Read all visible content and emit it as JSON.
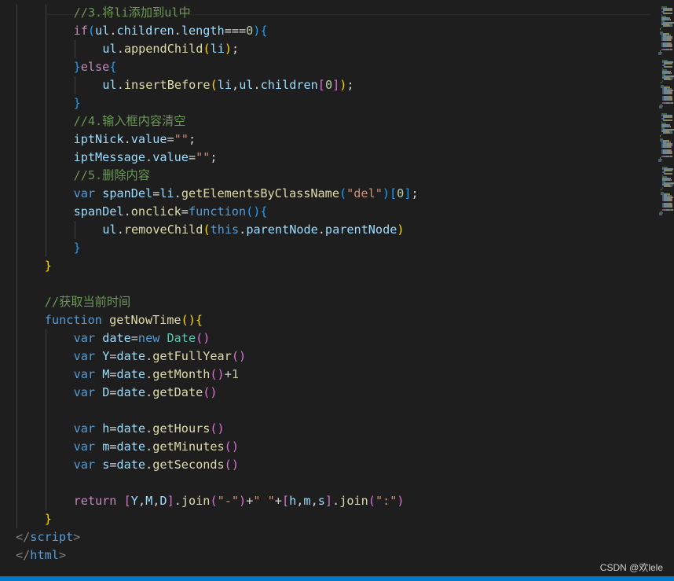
{
  "watermark": "CSDN @欢lele",
  "colors": {
    "background": "#1e1e1e",
    "comment": "#6a9955",
    "control_keyword": "#c586c0",
    "storage_keyword": "#569cd6",
    "variable": "#9cdcfe",
    "function": "#dcdcaa",
    "type": "#4ec9b0",
    "string": "#ce9178",
    "number": "#b5cea8",
    "bracket_level_1": "#ffd700",
    "bracket_level_2": "#da70d6",
    "bracket_level_3": "#179fff",
    "statusbar": "#007acc"
  },
  "code_lines": [
    {
      "indent": 2,
      "tokens": [
        {
          "t": "//3.将li添加到ul中",
          "c": "cm"
        }
      ]
    },
    {
      "indent": 2,
      "tokens": [
        {
          "t": "if",
          "c": "kw"
        },
        {
          "t": "(",
          "c": "b3"
        },
        {
          "t": "ul",
          "c": "vr"
        },
        {
          "t": ".",
          "c": "op"
        },
        {
          "t": "children",
          "c": "vr"
        },
        {
          "t": ".",
          "c": "op"
        },
        {
          "t": "length",
          "c": "vr"
        },
        {
          "t": "===",
          "c": "op"
        },
        {
          "t": "0",
          "c": "nm"
        },
        {
          "t": ")",
          "c": "b3"
        },
        {
          "t": "{",
          "c": "b3"
        }
      ]
    },
    {
      "indent": 3,
      "tokens": [
        {
          "t": "ul",
          "c": "vr"
        },
        {
          "t": ".",
          "c": "op"
        },
        {
          "t": "appendChild",
          "c": "fn"
        },
        {
          "t": "(",
          "c": "b1"
        },
        {
          "t": "li",
          "c": "vr"
        },
        {
          "t": ")",
          "c": "b1"
        },
        {
          "t": ";",
          "c": "op"
        }
      ]
    },
    {
      "indent": 2,
      "tokens": [
        {
          "t": "}",
          "c": "b3"
        },
        {
          "t": "else",
          "c": "kw"
        },
        {
          "t": "{",
          "c": "b3"
        }
      ]
    },
    {
      "indent": 3,
      "tokens": [
        {
          "t": "ul",
          "c": "vr"
        },
        {
          "t": ".",
          "c": "op"
        },
        {
          "t": "insertBefore",
          "c": "fn"
        },
        {
          "t": "(",
          "c": "b1"
        },
        {
          "t": "li",
          "c": "vr"
        },
        {
          "t": ",",
          "c": "op"
        },
        {
          "t": "ul",
          "c": "vr"
        },
        {
          "t": ".",
          "c": "op"
        },
        {
          "t": "children",
          "c": "vr"
        },
        {
          "t": "[",
          "c": "b2"
        },
        {
          "t": "0",
          "c": "nm"
        },
        {
          "t": "]",
          "c": "b2"
        },
        {
          "t": ")",
          "c": "b1"
        },
        {
          "t": ";",
          "c": "op"
        }
      ]
    },
    {
      "indent": 2,
      "tokens": [
        {
          "t": "}",
          "c": "b3"
        }
      ]
    },
    {
      "indent": 2,
      "tokens": [
        {
          "t": "//4.输入框内容清空",
          "c": "cm"
        }
      ]
    },
    {
      "indent": 2,
      "tokens": [
        {
          "t": "iptNick",
          "c": "vr"
        },
        {
          "t": ".",
          "c": "op"
        },
        {
          "t": "value",
          "c": "vr"
        },
        {
          "t": "=",
          "c": "op"
        },
        {
          "t": "\"\"",
          "c": "sr"
        },
        {
          "t": ";",
          "c": "op"
        }
      ]
    },
    {
      "indent": 2,
      "tokens": [
        {
          "t": "iptMessage",
          "c": "vr"
        },
        {
          "t": ".",
          "c": "op"
        },
        {
          "t": "value",
          "c": "vr"
        },
        {
          "t": "=",
          "c": "op"
        },
        {
          "t": "\"\"",
          "c": "sr"
        },
        {
          "t": ";",
          "c": "op"
        }
      ]
    },
    {
      "indent": 2,
      "tokens": [
        {
          "t": "//5.删除内容",
          "c": "cm"
        }
      ]
    },
    {
      "indent": 2,
      "tokens": [
        {
          "t": "var",
          "c": "st"
        },
        {
          "t": " ",
          "c": "op"
        },
        {
          "t": "spanDel",
          "c": "vr"
        },
        {
          "t": "=",
          "c": "op"
        },
        {
          "t": "li",
          "c": "vr"
        },
        {
          "t": ".",
          "c": "op"
        },
        {
          "t": "getElementsByClassName",
          "c": "fn"
        },
        {
          "t": "(",
          "c": "b3"
        },
        {
          "t": "\"del\"",
          "c": "sr"
        },
        {
          "t": ")",
          "c": "b3"
        },
        {
          "t": "[",
          "c": "b3"
        },
        {
          "t": "0",
          "c": "nm"
        },
        {
          "t": "]",
          "c": "b3"
        },
        {
          "t": ";",
          "c": "op"
        }
      ]
    },
    {
      "indent": 2,
      "tokens": [
        {
          "t": "spanDel",
          "c": "vr"
        },
        {
          "t": ".",
          "c": "op"
        },
        {
          "t": "onclick",
          "c": "fn"
        },
        {
          "t": "=",
          "c": "op"
        },
        {
          "t": "function",
          "c": "st"
        },
        {
          "t": "()",
          "c": "b3"
        },
        {
          "t": "{",
          "c": "b3"
        }
      ]
    },
    {
      "indent": 3,
      "tokens": [
        {
          "t": "ul",
          "c": "vr"
        },
        {
          "t": ".",
          "c": "op"
        },
        {
          "t": "removeChild",
          "c": "fn"
        },
        {
          "t": "(",
          "c": "b1"
        },
        {
          "t": "this",
          "c": "st"
        },
        {
          "t": ".",
          "c": "op"
        },
        {
          "t": "parentNode",
          "c": "vr"
        },
        {
          "t": ".",
          "c": "op"
        },
        {
          "t": "parentNode",
          "c": "vr"
        },
        {
          "t": ")",
          "c": "b1"
        }
      ]
    },
    {
      "indent": 2,
      "tokens": [
        {
          "t": "}",
          "c": "b3"
        }
      ]
    },
    {
      "indent": 1,
      "tokens": [
        {
          "t": "}",
          "c": "b1"
        }
      ]
    },
    {
      "indent": 0,
      "tokens": []
    },
    {
      "indent": 1,
      "tokens": [
        {
          "t": "//获取当前时间",
          "c": "cm"
        }
      ]
    },
    {
      "indent": 1,
      "tokens": [
        {
          "t": "function",
          "c": "st"
        },
        {
          "t": " ",
          "c": "op"
        },
        {
          "t": "getNowTime",
          "c": "fn"
        },
        {
          "t": "()",
          "c": "b1"
        },
        {
          "t": "{",
          "c": "b1"
        }
      ]
    },
    {
      "indent": 2,
      "tokens": [
        {
          "t": "var",
          "c": "st"
        },
        {
          "t": " ",
          "c": "op"
        },
        {
          "t": "date",
          "c": "vr"
        },
        {
          "t": "=",
          "c": "op"
        },
        {
          "t": "new",
          "c": "st"
        },
        {
          "t": " ",
          "c": "op"
        },
        {
          "t": "Date",
          "c": "tp"
        },
        {
          "t": "()",
          "c": "b2"
        }
      ]
    },
    {
      "indent": 2,
      "tokens": [
        {
          "t": "var",
          "c": "st"
        },
        {
          "t": " ",
          "c": "op"
        },
        {
          "t": "Y",
          "c": "vr"
        },
        {
          "t": "=",
          "c": "op"
        },
        {
          "t": "date",
          "c": "vr"
        },
        {
          "t": ".",
          "c": "op"
        },
        {
          "t": "getFullYear",
          "c": "fn"
        },
        {
          "t": "()",
          "c": "b2"
        }
      ]
    },
    {
      "indent": 2,
      "tokens": [
        {
          "t": "var",
          "c": "st"
        },
        {
          "t": " ",
          "c": "op"
        },
        {
          "t": "M",
          "c": "vr"
        },
        {
          "t": "=",
          "c": "op"
        },
        {
          "t": "date",
          "c": "vr"
        },
        {
          "t": ".",
          "c": "op"
        },
        {
          "t": "getMonth",
          "c": "fn"
        },
        {
          "t": "()",
          "c": "b2"
        },
        {
          "t": "+",
          "c": "op"
        },
        {
          "t": "1",
          "c": "nm"
        }
      ]
    },
    {
      "indent": 2,
      "tokens": [
        {
          "t": "var",
          "c": "st"
        },
        {
          "t": " ",
          "c": "op"
        },
        {
          "t": "D",
          "c": "vr"
        },
        {
          "t": "=",
          "c": "op"
        },
        {
          "t": "date",
          "c": "vr"
        },
        {
          "t": ".",
          "c": "op"
        },
        {
          "t": "getDate",
          "c": "fn"
        },
        {
          "t": "()",
          "c": "b2"
        }
      ]
    },
    {
      "indent": 0,
      "tokens": []
    },
    {
      "indent": 2,
      "tokens": [
        {
          "t": "var",
          "c": "st"
        },
        {
          "t": " ",
          "c": "op"
        },
        {
          "t": "h",
          "c": "vr"
        },
        {
          "t": "=",
          "c": "op"
        },
        {
          "t": "date",
          "c": "vr"
        },
        {
          "t": ".",
          "c": "op"
        },
        {
          "t": "getHours",
          "c": "fn"
        },
        {
          "t": "()",
          "c": "b2"
        }
      ]
    },
    {
      "indent": 2,
      "tokens": [
        {
          "t": "var",
          "c": "st"
        },
        {
          "t": " ",
          "c": "op"
        },
        {
          "t": "m",
          "c": "vr"
        },
        {
          "t": "=",
          "c": "op"
        },
        {
          "t": "date",
          "c": "vr"
        },
        {
          "t": ".",
          "c": "op"
        },
        {
          "t": "getMinutes",
          "c": "fn"
        },
        {
          "t": "()",
          "c": "b2"
        }
      ]
    },
    {
      "indent": 2,
      "tokens": [
        {
          "t": "var",
          "c": "st"
        },
        {
          "t": " ",
          "c": "op"
        },
        {
          "t": "s",
          "c": "vr"
        },
        {
          "t": "=",
          "c": "op"
        },
        {
          "t": "date",
          "c": "vr"
        },
        {
          "t": ".",
          "c": "op"
        },
        {
          "t": "getSeconds",
          "c": "fn"
        },
        {
          "t": "()",
          "c": "b2"
        }
      ]
    },
    {
      "indent": 0,
      "tokens": []
    },
    {
      "indent": 2,
      "tokens": [
        {
          "t": "return",
          "c": "kw"
        },
        {
          "t": " ",
          "c": "op"
        },
        {
          "t": "[",
          "c": "b2"
        },
        {
          "t": "Y",
          "c": "vr"
        },
        {
          "t": ",",
          "c": "op"
        },
        {
          "t": "M",
          "c": "vr"
        },
        {
          "t": ",",
          "c": "op"
        },
        {
          "t": "D",
          "c": "vr"
        },
        {
          "t": "]",
          "c": "b2"
        },
        {
          "t": ".",
          "c": "op"
        },
        {
          "t": "join",
          "c": "fn"
        },
        {
          "t": "(",
          "c": "b2"
        },
        {
          "t": "\"-\"",
          "c": "sr"
        },
        {
          "t": ")",
          "c": "b2"
        },
        {
          "t": "+",
          "c": "op"
        },
        {
          "t": "\" \"",
          "c": "sr"
        },
        {
          "t": "+",
          "c": "op"
        },
        {
          "t": "[",
          "c": "b2"
        },
        {
          "t": "h",
          "c": "vr"
        },
        {
          "t": ",",
          "c": "op"
        },
        {
          "t": "m",
          "c": "vr"
        },
        {
          "t": ",",
          "c": "op"
        },
        {
          "t": "s",
          "c": "vr"
        },
        {
          "t": "]",
          "c": "b2"
        },
        {
          "t": ".",
          "c": "op"
        },
        {
          "t": "join",
          "c": "fn"
        },
        {
          "t": "(",
          "c": "b2"
        },
        {
          "t": "\":\"",
          "c": "sr"
        },
        {
          "t": ")",
          "c": "b2"
        }
      ]
    },
    {
      "indent": 1,
      "tokens": [
        {
          "t": "}",
          "c": "b1"
        }
      ]
    },
    {
      "indent": 0,
      "tokens": [
        {
          "t": "</",
          "c": "tg"
        },
        {
          "t": "script",
          "c": "tn"
        },
        {
          "t": ">",
          "c": "tg"
        }
      ]
    },
    {
      "indent": 0,
      "tokens": [
        {
          "t": "</",
          "c": "tg"
        },
        {
          "t": "html",
          "c": "tn"
        },
        {
          "t": ">",
          "c": "tg"
        }
      ]
    }
  ]
}
